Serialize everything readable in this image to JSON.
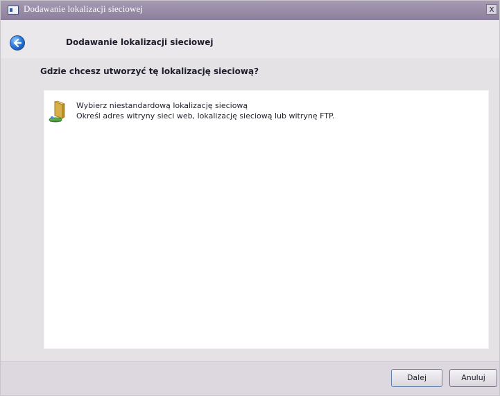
{
  "window": {
    "title": "Dodawanie lokalizacji sieciowej",
    "close_label": "x"
  },
  "header": {
    "title": "Dodawanie lokalizacji sieciowej",
    "back_icon": "back-arrow-icon"
  },
  "content": {
    "question": "Gdzie chcesz utworzyć tę lokalizację sieciową?",
    "items": [
      {
        "title": "Wybierz niestandardową lokalizację sieciową",
        "description": "Określ adres witryny sieci web, lokalizację sieciową lub witrynę FTP.",
        "icon": "network-folder-icon"
      }
    ]
  },
  "footer": {
    "next_label": "Dalej",
    "cancel_label": "Anuluj"
  },
  "colors": {
    "titlebar": "#8c7f9c",
    "accent_blue": "#2f7ddb"
  }
}
